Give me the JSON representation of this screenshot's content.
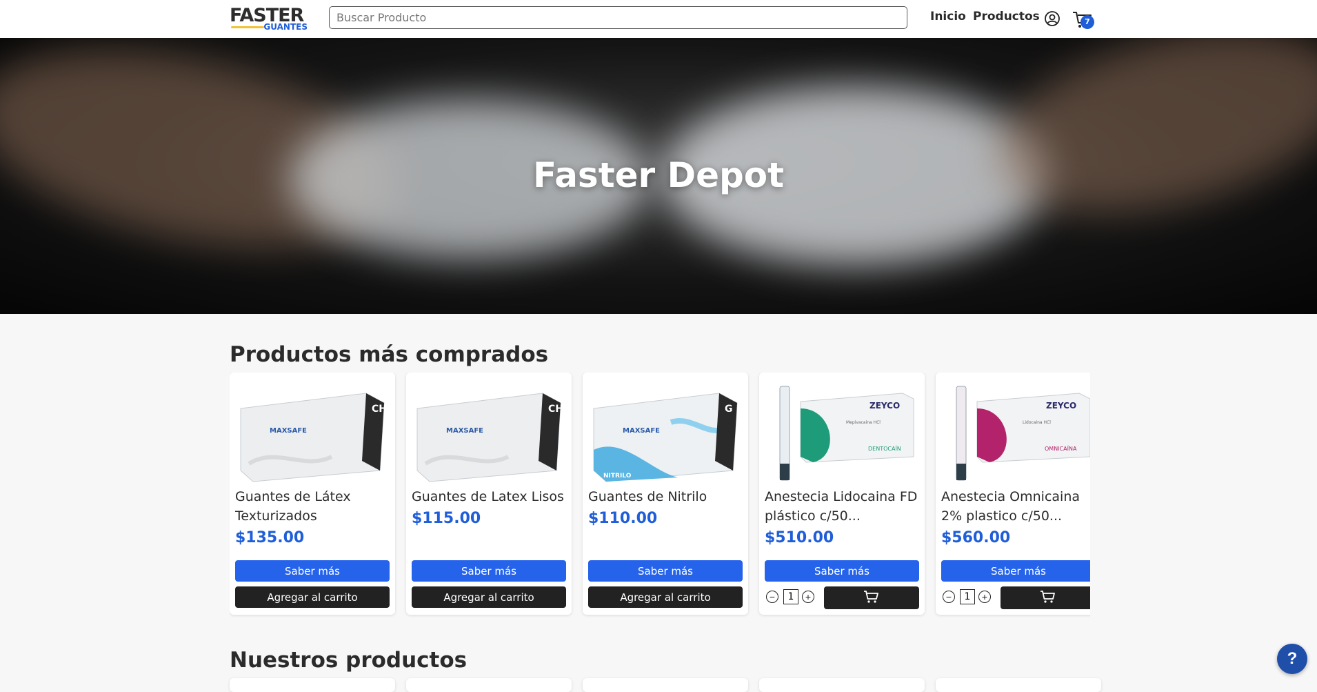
{
  "header": {
    "logo_main": "FASTER",
    "logo_sub": "GUANTES",
    "search_placeholder": "Buscar Producto",
    "nav": [
      "Inicio",
      "Productos"
    ],
    "cart_count": "7",
    "icons": [
      "user-icon",
      "cart-icon"
    ]
  },
  "hero": {
    "title": "Faster Depot"
  },
  "featured": {
    "title": "Productos más comprados",
    "products": [
      {
        "name": "Guantes de Látex Texturizados",
        "price": "$135.00",
        "info_label": "Saber más",
        "add_label": "Agregar al carrito",
        "box_brand": "MAXSAFE",
        "box_size": "CH"
      },
      {
        "name": "Guantes de Latex Lisos",
        "price": "$115.00",
        "info_label": "Saber más",
        "add_label": "Agregar al carrito",
        "box_brand": "MAXSAFE",
        "box_size": "CH"
      },
      {
        "name": "Guantes de Nitrilo",
        "price": "$110.00",
        "info_label": "Saber más",
        "add_label": "Agregar al carrito",
        "box_brand": "MAXSAFE",
        "box_size": "G",
        "box_tag": "NITRILO"
      },
      {
        "name": "Anestecia Lidocaina FD plástico c/50...",
        "price": "$510.00",
        "info_label": "Saber más",
        "qty": "1",
        "box_brand": "ZEYCO",
        "box_line": "Mepivacaina HCl",
        "box_product": "DENTOCAÍN",
        "accent": "#1e9c7a"
      },
      {
        "name": "Anestecia Omnicaina 2% plastico c/50...",
        "price": "$560.00",
        "info_label": "Saber más",
        "qty": "1",
        "box_brand": "ZEYCO",
        "box_line": "Lidocaina HCl",
        "box_product": "OMNICAÍNA",
        "accent": "#b3236c"
      }
    ]
  },
  "catalog": {
    "title": "Nuestros productos"
  },
  "help": {
    "label": "?"
  },
  "colors": {
    "primary": "#2563eb",
    "price": "#1f5ed8",
    "dark_button": "#222222",
    "logo_accent": "#f2c230"
  }
}
